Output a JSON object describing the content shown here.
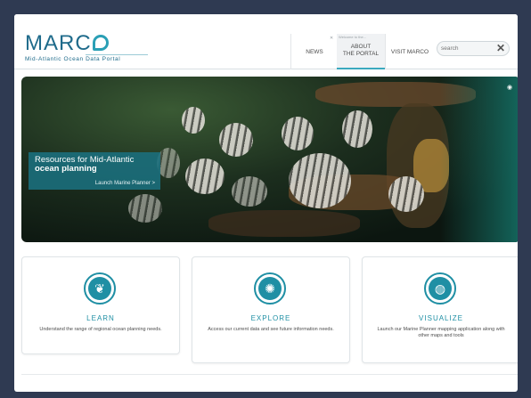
{
  "header": {
    "logo_text": "MARC",
    "logo_subtitle": "Mid-Atlantic Ocean Data Portal",
    "nav": {
      "news": "NEWS",
      "about_tip": "Welcome to the...",
      "about_line1": "ABOUT",
      "about_line2": "THE PORTAL",
      "visit": "VISIT MARCO"
    },
    "search": {
      "placeholder": "search",
      "clear_label": "✕"
    }
  },
  "hero": {
    "title_line1": "Resources for Mid-Atlantic",
    "title_line2": "ocean planning",
    "link": "Launch Marine Planner >"
  },
  "cards": [
    {
      "title": "LEARN",
      "description": "Understand the range of regional ocean planning needs.",
      "icon": "apple-icon"
    },
    {
      "title": "EXPLORE",
      "description": "Access our current data and see future information needs.",
      "icon": "network-icon"
    },
    {
      "title": "VISUALIZE",
      "description": "Launch our Marine Planner mapping application along with other maps and tools",
      "icon": "globe-icon"
    }
  ],
  "colors": {
    "accent": "#1f8fa4",
    "brand": "#1f6b8b",
    "background": "#2f3a52"
  }
}
